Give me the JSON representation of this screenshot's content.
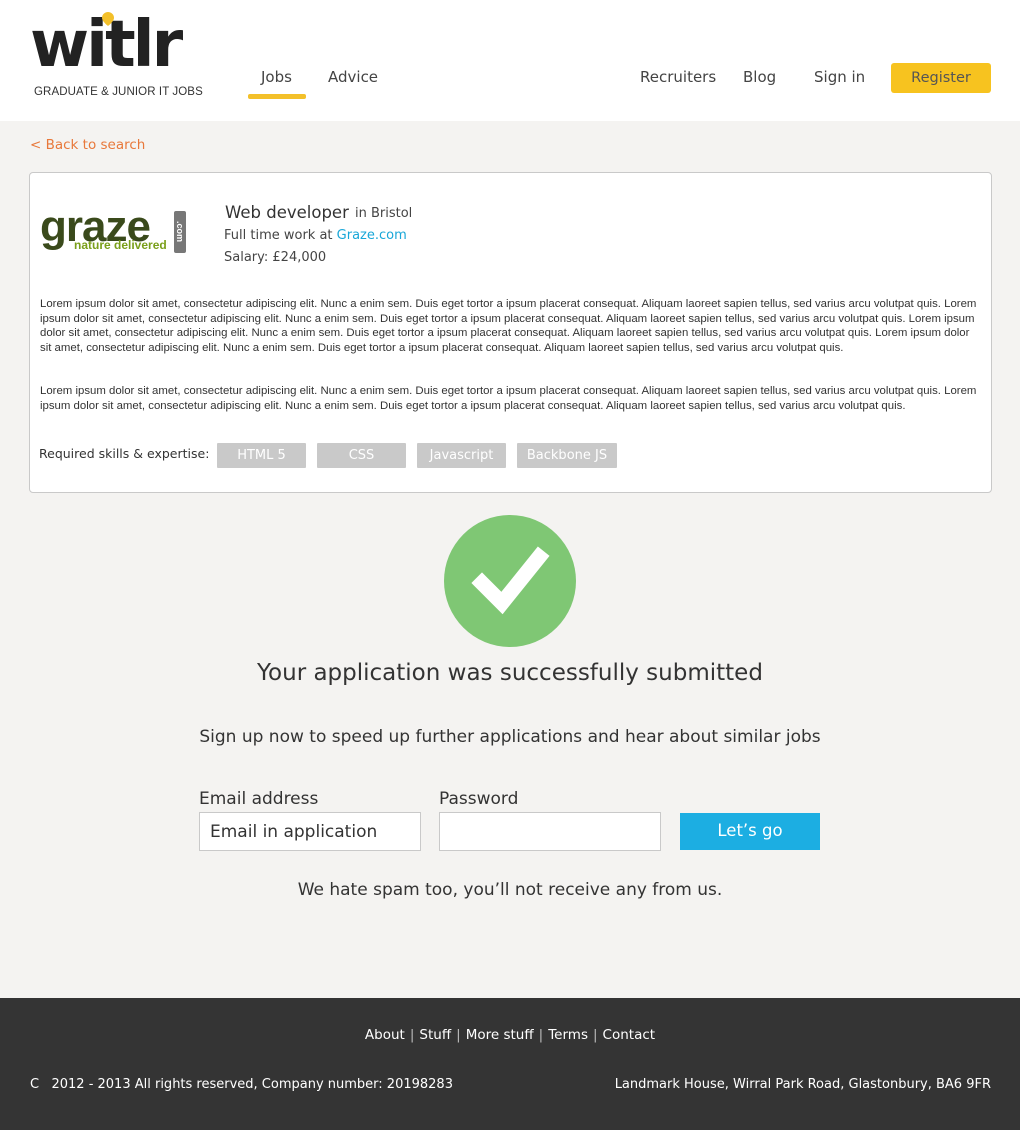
{
  "brand": {
    "name": "witlr",
    "tagline": "GRADUATE & JUNIOR IT JOBS",
    "accent_color": "#f7c31f"
  },
  "nav": {
    "jobs": "Jobs",
    "advice": "Advice",
    "recruiters": "Recruiters",
    "blog": "Blog",
    "sign_in": "Sign in",
    "register": "Register"
  },
  "back_link": "< Back to search",
  "job": {
    "company_logo_text": "graze",
    "company_logo_tagline": "nature delivered",
    "company_logo_suffix": ".com",
    "title": "Web developer",
    "location": "in Bristol",
    "type_prefix": "Full time work at",
    "company": "Graze.com",
    "salary": "Salary: £24,000",
    "description": [
      "Lorem ipsum dolor sit amet, consectetur adipiscing elit. Nunc a enim sem. Duis eget tortor a ipsum placerat consequat. Aliquam laoreet sapien tellus, sed varius arcu volutpat quis. Lorem ipsum dolor sit amet, consectetur adipiscing elit. Nunc a enim sem. Duis eget tortor a ipsum placerat consequat. Aliquam laoreet sapien tellus, sed varius arcu volutpat quis. Lorem ipsum dolor sit amet, consectetur adipiscing elit. Nunc a enim sem. Duis eget tortor a ipsum placerat consequat. Aliquam laoreet sapien tellus, sed varius arcu volutpat quis. Lorem ipsum dolor sit amet, consectetur adipiscing elit. Nunc a enim sem. Duis eget tortor a ipsum placerat consequat. Aliquam laoreet sapien tellus, sed varius arcu volutpat quis.",
      "Lorem ipsum dolor sit amet, consectetur adipiscing elit. Nunc a enim sem. Duis eget tortor a ipsum placerat consequat. Aliquam laoreet sapien tellus, sed varius arcu volutpat quis. Lorem ipsum dolor sit amet, consectetur adipiscing elit. Nunc a enim sem. Duis eget tortor a ipsum placerat consequat. Aliquam laoreet sapien tellus, sed varius arcu volutpat quis."
    ],
    "skills_label": "Required skills & expertise:",
    "skills": [
      "HTML 5",
      "CSS",
      "Javascript",
      "Backbone JS"
    ]
  },
  "success": {
    "icon": "check-icon",
    "color": "#7fc774",
    "title": "Your application was successfully submitted",
    "signup_prompt": "Sign up now to speed up further applications and hear about similar jobs"
  },
  "form": {
    "email_label": "Email address",
    "email_value": "Email in application",
    "password_label": "Password",
    "password_value": "",
    "submit_label": "Let’s go",
    "submit_color": "#1caee2",
    "spam_note": "We hate spam too, you’ll not receive any from us."
  },
  "footer": {
    "links": [
      "About",
      "Stuff",
      "More stuff",
      "Terms",
      "Contact"
    ],
    "separator": "|",
    "copyright": "C   2012 - 2013 All rights reserved, Company number: 20198283",
    "address": "Landmark House, Wirral Park Road, Glastonbury, BA6 9FR"
  }
}
